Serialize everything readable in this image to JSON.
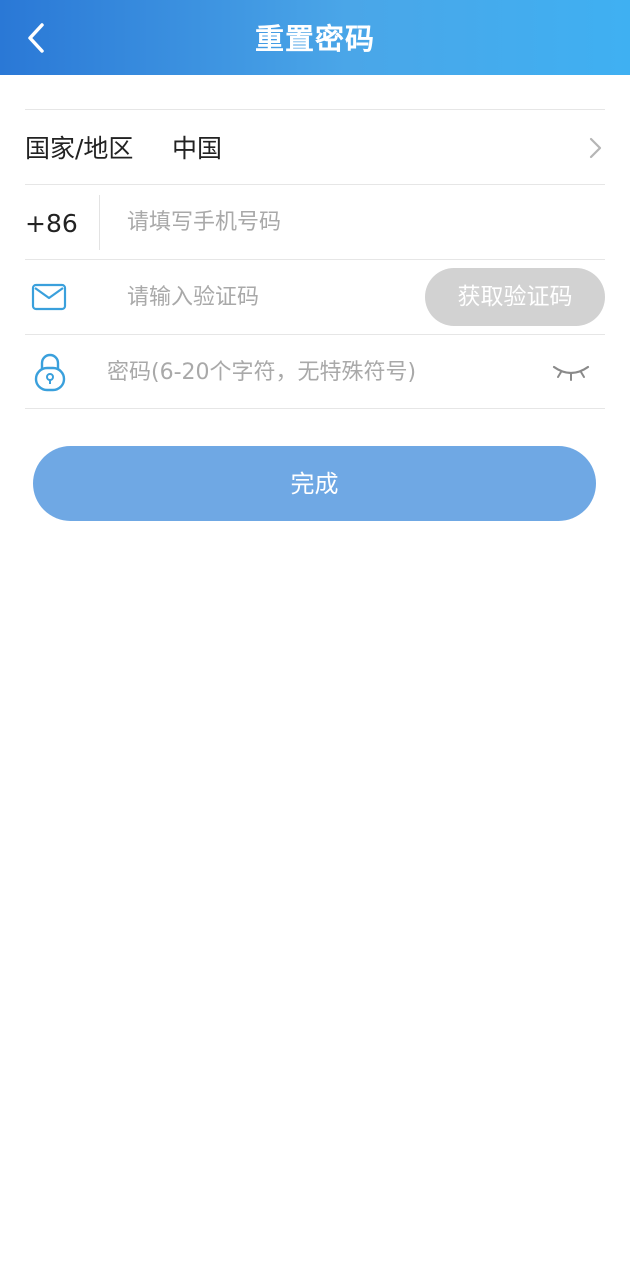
{
  "header": {
    "title": "重置密码",
    "background_start": "#2a78d6",
    "background_end": "#3fb0f2"
  },
  "form": {
    "region": {
      "label": "国家/地区",
      "value": "中国"
    },
    "phone": {
      "country_code": "+86",
      "placeholder": "请填写手机号码",
      "value": ""
    },
    "code": {
      "icon": "mail-icon",
      "placeholder": "请输入验证码",
      "value": "",
      "button_label": "获取验证码"
    },
    "password": {
      "icon": "lock-icon",
      "placeholder": "密码(6-20个字符，无特殊符号)",
      "value": "",
      "toggle_icon": "eye-closed-icon"
    }
  },
  "submit": {
    "label": "完成",
    "color": "#6fa8e4"
  },
  "colors": {
    "accent": "#3aa0dc",
    "disabled_button": "#d2d2d2"
  }
}
